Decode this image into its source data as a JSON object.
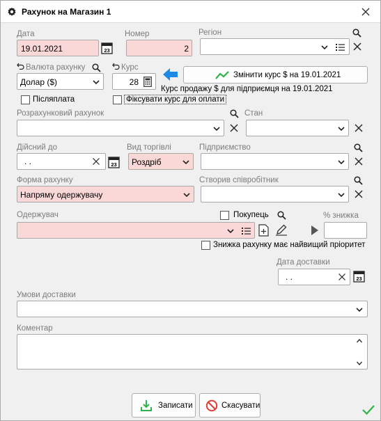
{
  "window": {
    "title": "Рахунок на Магазин 1"
  },
  "date": {
    "label": "Дата",
    "value": "19.01.2021"
  },
  "number": {
    "label": "Номер",
    "value": "2"
  },
  "region": {
    "label": "Регіон",
    "value": ""
  },
  "currency": {
    "label": "Валюта рахунку",
    "value": "Долар ($)"
  },
  "rate": {
    "label": "Курс",
    "value": "28"
  },
  "change_rate_button": {
    "label": "Змінити курс $ на 19.01.2021"
  },
  "rate_info": "Курс продажу $ для підприємця на 19.01.2021",
  "postpay": {
    "label": "Післяплата",
    "checked": false
  },
  "fix_rate": {
    "label": "Фіксувати курс для оплати",
    "checked": false
  },
  "settlement_account": {
    "label": "Розрахунковий рахунок",
    "value": ""
  },
  "status": {
    "label": "Стан",
    "value": ""
  },
  "valid_until": {
    "label": "Дійсний до",
    "value": ". ."
  },
  "trade_type": {
    "label": "Вид торгівлі",
    "value": "Роздріб"
  },
  "enterprise": {
    "label": "Підприємство",
    "value": ""
  },
  "payment_form": {
    "label": "Форма рахунку",
    "value": "Напряму одержувачу"
  },
  "created_by": {
    "label": "Створив співробітник",
    "value": ""
  },
  "recipient": {
    "label": "Одержувач",
    "value": ""
  },
  "buyer": {
    "label": "Покупець",
    "checked": false
  },
  "discount": {
    "label": "% знижка",
    "value": ""
  },
  "discount_priority": {
    "label": "Знижка рахунку має найвищий пріоритет",
    "checked": false
  },
  "delivery_date": {
    "label": "Дата доставки",
    "value": ". ."
  },
  "delivery_terms": {
    "label": "Умови доставки",
    "value": ""
  },
  "comment": {
    "label": "Коментар",
    "value": ""
  },
  "buttons": {
    "save": "Записати",
    "cancel": "Скасувати"
  },
  "colors": {
    "required_bg": "#fbd8d8",
    "accent_green": "#2db34a",
    "accent_blue": "#1e88e5",
    "cancel_red": "#e53935"
  }
}
